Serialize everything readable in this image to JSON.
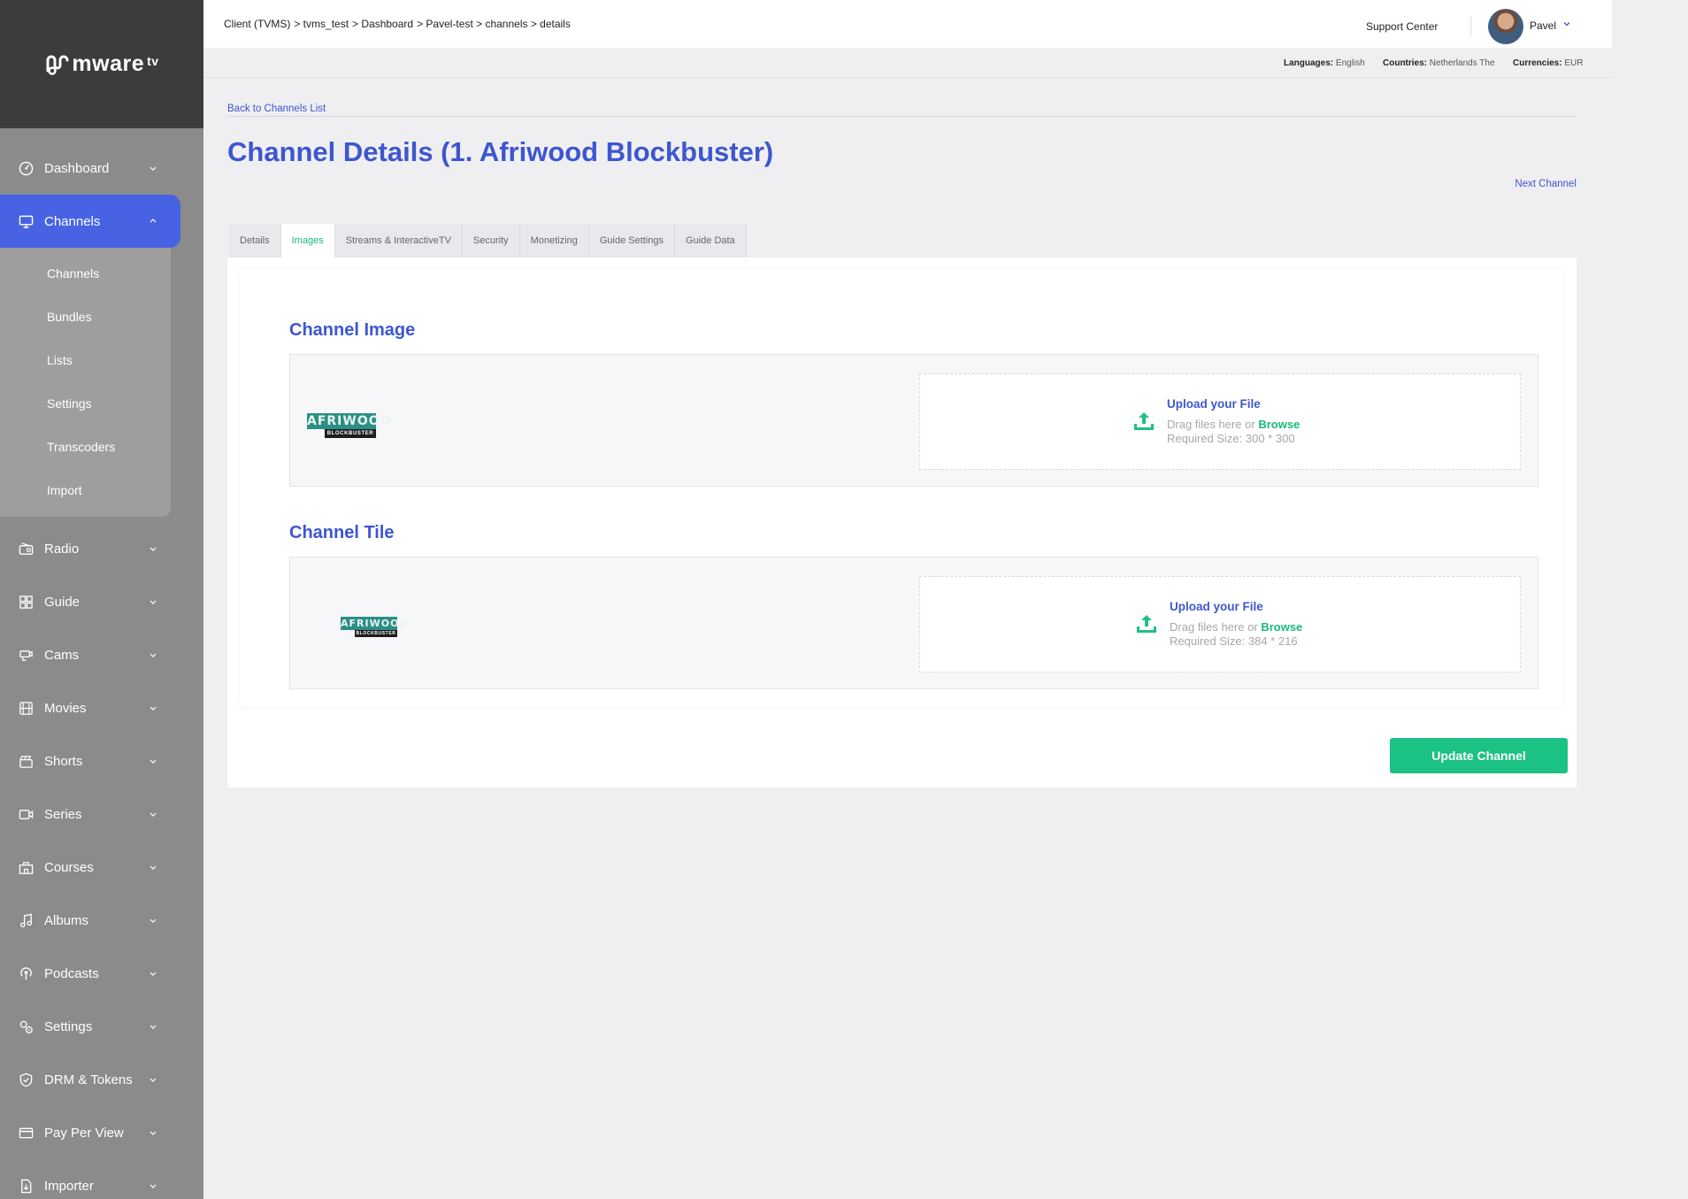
{
  "brand": {
    "logo_text": "mware",
    "logo_sup": "tv"
  },
  "sidebar": {
    "items": [
      {
        "label": "Dashboard"
      },
      {
        "label": "Channels"
      },
      {
        "label": "Radio"
      },
      {
        "label": "Guide"
      },
      {
        "label": "Cams"
      },
      {
        "label": "Movies"
      },
      {
        "label": "Shorts"
      },
      {
        "label": "Series"
      },
      {
        "label": "Courses"
      },
      {
        "label": "Albums"
      },
      {
        "label": "Podcasts"
      },
      {
        "label": "Settings"
      },
      {
        "label": "DRM & Tokens"
      },
      {
        "label": "Pay Per View"
      },
      {
        "label": "Importer"
      }
    ],
    "channels_submenu": [
      "Channels",
      "Bundles",
      "Lists",
      "Settings",
      "Transcoders",
      "Import"
    ]
  },
  "topbar": {
    "breadcrumb": [
      "Client (TVMS)",
      "> tvms_test",
      "> Dashboard",
      "> Pavel-test > channels > details"
    ],
    "support": "Support Center",
    "user": "Pavel"
  },
  "infobar": {
    "languages_label": "Languages:",
    "languages": "English",
    "countries_label": "Countries:",
    "countries": "Netherlands The",
    "currencies_label": "Currencies:",
    "currencies": "EUR"
  },
  "page": {
    "back_link": "Back to Channels List",
    "title": "Channel Details (1. Afriwood Blockbuster)",
    "next_link": "Next Channel",
    "tabs": [
      "Details",
      "Images",
      "Streams & InteractiveTV",
      "Security",
      "Monetizing",
      "Guide Settings",
      "Guide Data"
    ],
    "active_tab": "Images"
  },
  "images": {
    "channel_image": {
      "title": "Channel Image",
      "logo_top": "AFRIWOOD",
      "logo_bottom": "BLOCKBUSTER",
      "upload_title": "Upload your File",
      "drag_text": "Drag files here or ",
      "browse": "Browse",
      "required": "Required Size: 300 * 300"
    },
    "channel_tile": {
      "title": "Channel Tile",
      "logo_top": "AFRIWOOD",
      "logo_bottom": "BLOCKBUSTER",
      "upload_title": "Upload your File",
      "drag_text": "Drag files here or ",
      "browse": "Browse",
      "required": "Required Size: 384 * 216"
    }
  },
  "actions": {
    "update": "Update Channel"
  },
  "colors": {
    "accent": "#4763e4",
    "title_blue": "#3d56d0",
    "green": "#1cc184",
    "sidebar": "#8b8b8b"
  }
}
